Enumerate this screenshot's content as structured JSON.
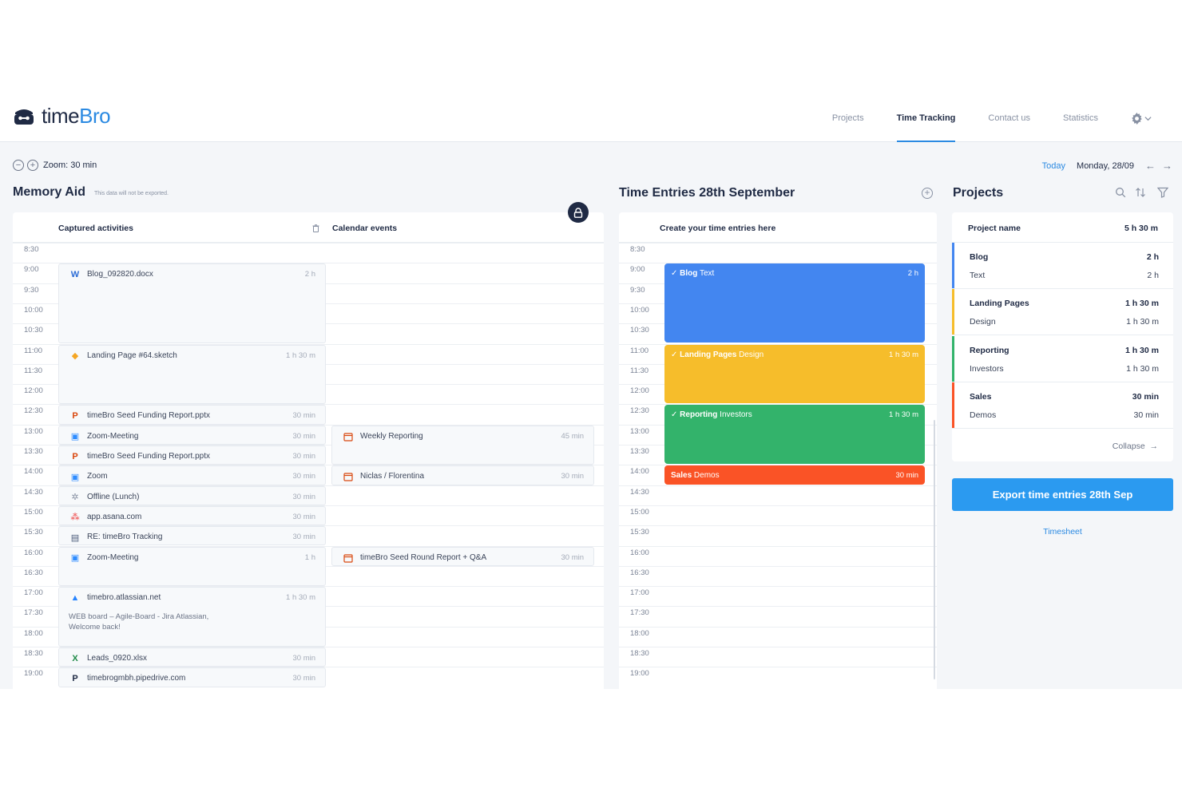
{
  "app": {
    "brand_prefix": "time",
    "brand_suffix": "Bro",
    "nav": [
      "Projects",
      "Time Tracking",
      "Contact us",
      "Statistics"
    ],
    "active_nav": "Time Tracking"
  },
  "toolbar": {
    "zoom_label": "Zoom: 30 min",
    "today": "Today",
    "date": "Monday, 28/09"
  },
  "memory_aid": {
    "title": "Memory Aid",
    "note": "This data will not be exported.",
    "captured_header": "Captured activities",
    "calendar_header": "Calendar events"
  },
  "times": [
    "8:30",
    "9:00",
    "9:30",
    "10:00",
    "10:30",
    "11:00",
    "11:30",
    "12:00",
    "12:30",
    "13:00",
    "13:30",
    "14:00",
    "14:30",
    "15:00",
    "15:30",
    "16:00",
    "16:30",
    "17:00",
    "17:30",
    "18:00",
    "18:30",
    "19:00"
  ],
  "activities": [
    {
      "name": "Blog_092820.docx",
      "duration": "2 h",
      "start": 1,
      "span": 4,
      "icon": "word-icon",
      "glyph": "W",
      "color": "#2b6cd6"
    },
    {
      "name": "Landing Page #64.sketch",
      "duration": "1 h 30 m",
      "start": 5,
      "span": 3,
      "icon": "sketch-icon",
      "glyph": "◆",
      "color": "#f5a623"
    },
    {
      "name": "timeBro Seed Funding Report.pptx",
      "duration": "30 min",
      "start": 8,
      "span": 1,
      "icon": "powerpoint-icon",
      "glyph": "P",
      "color": "#d9480f"
    },
    {
      "name": "Zoom-Meeting",
      "duration": "30 min",
      "start": 9,
      "span": 1,
      "icon": "zoom-icon",
      "glyph": "▣",
      "color": "#2d8cff"
    },
    {
      "name": "timeBro Seed Funding Report.pptx",
      "duration": "30 min",
      "start": 10,
      "span": 1,
      "icon": "powerpoint-icon",
      "glyph": "P",
      "color": "#d9480f"
    },
    {
      "name": "Zoom",
      "duration": "30 min",
      "start": 11,
      "span": 1,
      "icon": "zoom-icon",
      "glyph": "▣",
      "color": "#2d8cff"
    },
    {
      "name": "Offline (Lunch)",
      "duration": "30 min",
      "start": 12,
      "span": 1,
      "icon": "offline-icon",
      "glyph": "✲",
      "color": "#8891a3"
    },
    {
      "name": "app.asana.com",
      "duration": "30 min",
      "start": 13,
      "span": 1,
      "icon": "asana-icon",
      "glyph": "⁂",
      "color": "#f06a6a"
    },
    {
      "name": "RE: timeBro Tracking",
      "duration": "30 min",
      "start": 14,
      "span": 1,
      "icon": "mail-icon",
      "glyph": "▤",
      "color": "#4a5a7a"
    },
    {
      "name": "Zoom-Meeting",
      "duration": "1 h",
      "start": 15,
      "span": 2,
      "icon": "zoom-icon",
      "glyph": "▣",
      "color": "#2d8cff"
    },
    {
      "name": "timebro.atlassian.net",
      "duration": "1 h 30 m",
      "start": 17,
      "span": 3,
      "icon": "atlassian-icon",
      "glyph": "▲",
      "color": "#2684ff",
      "extra": "WEB board – Agile-Board - Jira Atlassian, Welcome back!"
    },
    {
      "name": "Leads_0920.xlsx",
      "duration": "30 min",
      "start": 20,
      "span": 1,
      "icon": "excel-icon",
      "glyph": "X",
      "color": "#1e8a47"
    },
    {
      "name": "timebrogmbh.pipedrive.com",
      "duration": "30 min",
      "start": 21,
      "span": 1,
      "icon": "pipedrive-icon",
      "glyph": "P",
      "color": "#1f2a44"
    }
  ],
  "calendar_events": [
    {
      "name": "Weekly Reporting",
      "duration": "45 min",
      "start": 9,
      "span": 2
    },
    {
      "name": "Niclas / Florentina",
      "duration": "30 min",
      "start": 11,
      "span": 1
    },
    {
      "name": "timeBro Seed Round Report + Q&A",
      "duration": "30 min",
      "start": 15,
      "span": 1
    }
  ],
  "time_entries": {
    "title": "Time Entries 28th September",
    "header": "Create your time entries here",
    "entries": [
      {
        "project": "Blog",
        "task": "Text",
        "duration": "2 h",
        "start": 1,
        "span": 4,
        "color": "#4386f0",
        "checked": true
      },
      {
        "project": "Landing Pages",
        "task": "Design",
        "duration": "1 h 30 m",
        "start": 5,
        "span": 3,
        "color": "#f6bd2b",
        "checked": true
      },
      {
        "project": "Reporting",
        "task": "Investors",
        "duration": "1 h 30 m",
        "start": 8,
        "span": 3,
        "color": "#33b36b",
        "checked": true
      },
      {
        "project": "Sales",
        "task": "Demos",
        "duration": "30 min",
        "start": 11,
        "span": 1,
        "color": "#fa5326",
        "checked": false
      }
    ]
  },
  "projects": {
    "title": "Projects",
    "header_name": "Project name",
    "header_total": "5 h 30 m",
    "rows": [
      {
        "name": "Blog",
        "value": "2 h",
        "sub": "Text",
        "sub_value": "2 h",
        "color": "#4386f0"
      },
      {
        "name": "Landing Pages",
        "value": "1 h 30 m",
        "sub": "Design",
        "sub_value": "1 h 30 m",
        "color": "#f6bd2b"
      },
      {
        "name": "Reporting",
        "value": "1 h 30 m",
        "sub": "Investors",
        "sub_value": "1 h 30 m",
        "color": "#33b36b"
      },
      {
        "name": "Sales",
        "value": "30 min",
        "sub": "Demos",
        "sub_value": "30 min",
        "color": "#fa5326"
      }
    ],
    "collapse": "Collapse",
    "export": "Export time entries 28th Sep",
    "timesheet": "Timesheet"
  }
}
